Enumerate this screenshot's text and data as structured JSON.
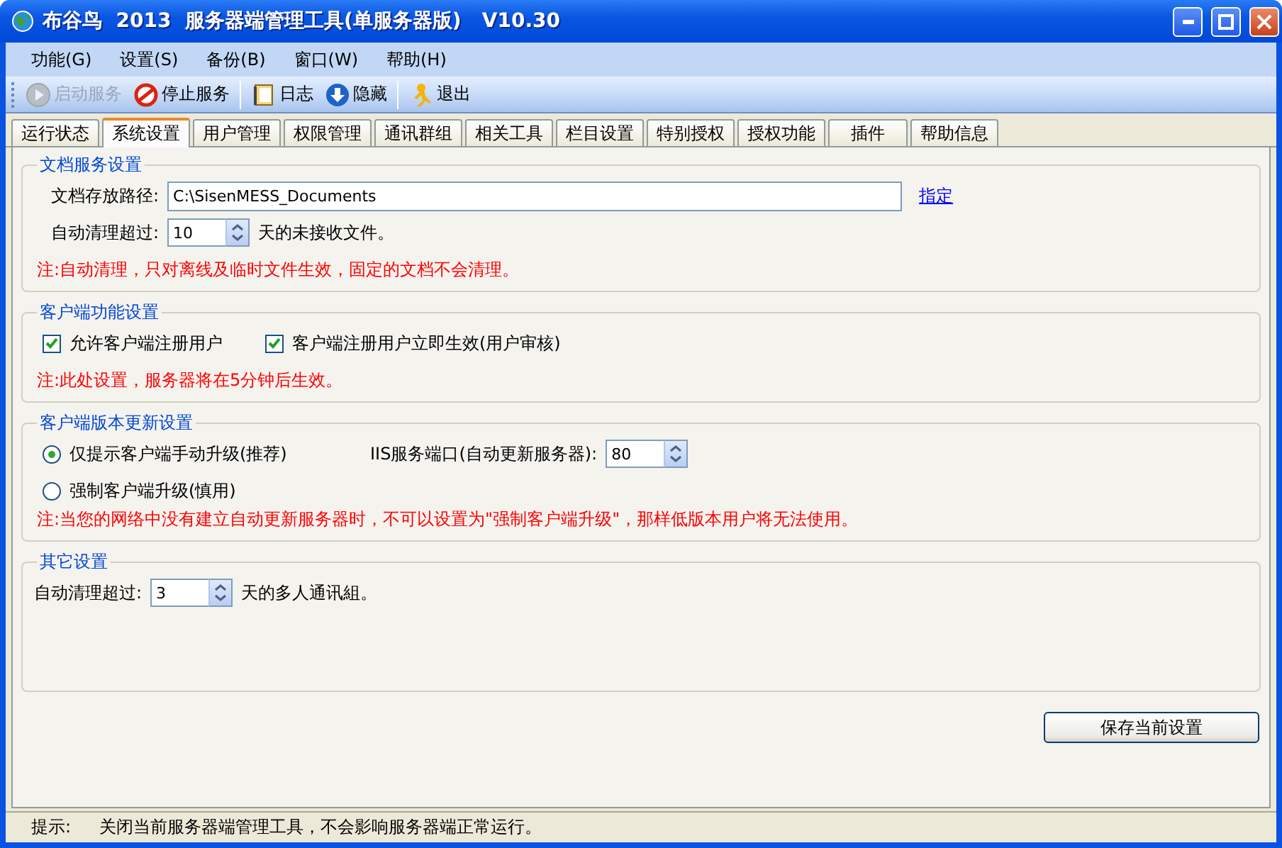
{
  "window": {
    "title": "布谷鸟  2013  服务器端管理工具(单服务器版)   V10.30"
  },
  "menu": [
    "功能(G)",
    "设置(S)",
    "备份(B)",
    "窗口(W)",
    "帮助(H)"
  ],
  "toolbar": [
    {
      "kind": "play",
      "label": "启动服务",
      "disabled": true
    },
    {
      "kind": "stop",
      "label": "停止服务",
      "disabled": false
    },
    {
      "kind": "separator"
    },
    {
      "kind": "log",
      "label": "日志",
      "disabled": false
    },
    {
      "kind": "hide",
      "label": "隐藏",
      "disabled": false
    },
    {
      "kind": "separator"
    },
    {
      "kind": "exit",
      "label": "退出",
      "disabled": false
    }
  ],
  "tabs": [
    {
      "label": "运行状态",
      "selected": false
    },
    {
      "label": "系统设置",
      "selected": true
    },
    {
      "label": "用户管理",
      "selected": false
    },
    {
      "label": "权限管理",
      "selected": false
    },
    {
      "label": "通讯群组",
      "selected": false
    },
    {
      "label": "相关工具",
      "selected": false
    },
    {
      "label": "栏目设置",
      "selected": false
    },
    {
      "label": "特别授权",
      "selected": false
    },
    {
      "label": "授权功能",
      "selected": false
    },
    {
      "label": "插件",
      "selected": false
    },
    {
      "label": "帮助信息",
      "selected": false
    }
  ],
  "document_service": {
    "title": "文档服务设置",
    "path_label": "文档存放路径:",
    "path_value": "C:\\SisenMESS_Documents",
    "browse_link": "指定",
    "cleanup_label": "自动清理超过:",
    "cleanup_value": "10",
    "cleanup_suffix": "天的未接收文件。",
    "note": "注:自动清理，只对离线及临时文件生效，固定的文档不会清理。"
  },
  "client_functions": {
    "title": "客户端功能设置",
    "checkboxes": [
      {
        "label": "允许客户端注册用户",
        "checked": true
      },
      {
        "label": "客户端注册用户立即生效(用户审核)",
        "checked": true
      }
    ],
    "note": "注:此处设置，服务器将在5分钟后生效。"
  },
  "client_update": {
    "title": "客户端版本更新设置",
    "radios": [
      {
        "label": "仅提示客户端手动升级(推荐)",
        "selected": true
      },
      {
        "label": "强制客户端升级(慎用)",
        "selected": false
      }
    ],
    "port_label": "IIS服务端口(自动更新服务器):",
    "port_value": "80",
    "note": "注:当您的网络中没有建立自动更新服务器时，不可以设置为\"强制客户端升级\"，那样低版本用户将无法使用。"
  },
  "other": {
    "title": "其它设置",
    "cleanup_label": "自动清理超过:",
    "cleanup_value": "3",
    "cleanup_suffix": "天的多人通讯組。"
  },
  "save_button": "保存当前设置",
  "status_bar": {
    "label": "提示:",
    "text": "关闭当前服务器端管理工具，不会影响服务器端正常运行。"
  }
}
